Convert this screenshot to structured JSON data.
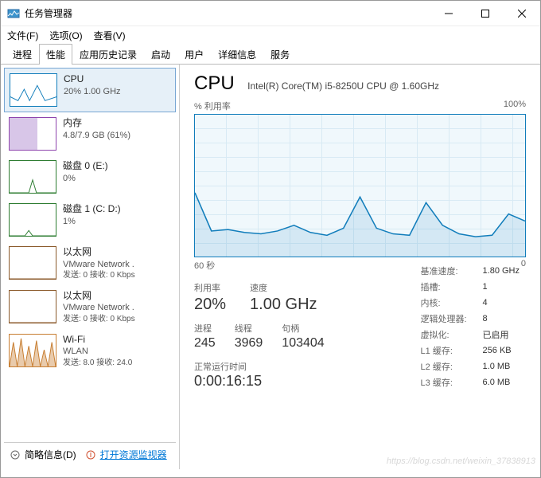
{
  "window": {
    "title": "任务管理器"
  },
  "menus": {
    "file": "文件(F)",
    "options": "选项(O)",
    "view": "查看(V)"
  },
  "tabs": [
    "进程",
    "性能",
    "应用历史记录",
    "启动",
    "用户",
    "详细信息",
    "服务"
  ],
  "active_tab": 1,
  "sidebar": [
    {
      "key": "cpu",
      "name": "CPU",
      "sub": "20% 1.00 GHz"
    },
    {
      "key": "mem",
      "name": "内存",
      "sub": "4.8/7.9 GB (61%)"
    },
    {
      "key": "disk0",
      "name": "磁盘 0 (E:)",
      "sub": "0%"
    },
    {
      "key": "disk1",
      "name": "磁盘 1 (C: D:)",
      "sub": "1%"
    },
    {
      "key": "eth0",
      "name": "以太网",
      "sub": "VMware Network .",
      "io": "发送: 0 接收: 0 Kbps"
    },
    {
      "key": "eth1",
      "name": "以太网",
      "sub": "VMware Network .",
      "io": "发送: 0 接收: 0 Kbps"
    },
    {
      "key": "wifi",
      "name": "Wi-Fi",
      "sub": "WLAN",
      "io": "发送: 8.0 接收: 24.0"
    }
  ],
  "main": {
    "title": "CPU",
    "model": "Intel(R) Core(TM) i5-8250U CPU @ 1.60GHz",
    "chart_top_left": "% 利用率",
    "chart_top_right": "100%",
    "axis_left": "60 秒",
    "axis_right": "0",
    "stats1": [
      {
        "lbl": "利用率",
        "val": "20%"
      },
      {
        "lbl": "速度",
        "val": "1.00 GHz"
      }
    ],
    "stats2": [
      {
        "lbl": "进程",
        "val": "245"
      },
      {
        "lbl": "线程",
        "val": "3969"
      },
      {
        "lbl": "句柄",
        "val": "103404"
      }
    ],
    "uptime": {
      "lbl": "正常运行时间",
      "val": "0:00:16:15"
    },
    "right": [
      {
        "k": "基准速度:",
        "v": "1.80 GHz"
      },
      {
        "k": "插槽:",
        "v": "1"
      },
      {
        "k": "内核:",
        "v": "4"
      },
      {
        "k": "逻辑处理器:",
        "v": "8"
      },
      {
        "k": "虚拟化:",
        "v": "已启用",
        "hl": true
      },
      {
        "k": "L1 缓存:",
        "v": "256 KB"
      },
      {
        "k": "L2 缓存:",
        "v": "1.0 MB"
      },
      {
        "k": "L3 缓存:",
        "v": "6.0 MB"
      }
    ]
  },
  "footer": {
    "less": "简略信息(D)",
    "resmon": "打开资源监视器"
  },
  "watermark": "https://blog.csdn.net/weixin_37838913",
  "colors": {
    "cpu": "#117dbb"
  },
  "chart_data": {
    "type": "line",
    "title": "% 利用率",
    "xlabel": "60 秒 → 0",
    "ylabel": "% 利用率",
    "ylim": [
      0,
      100
    ],
    "x_seconds": [
      60,
      57,
      54,
      51,
      48,
      45,
      42,
      39,
      36,
      33,
      30,
      27,
      24,
      21,
      18,
      15,
      12,
      9,
      6,
      3,
      0
    ],
    "values": [
      45,
      18,
      19,
      17,
      16,
      18,
      22,
      17,
      15,
      20,
      42,
      20,
      16,
      15,
      38,
      22,
      16,
      14,
      15,
      30,
      25
    ]
  }
}
